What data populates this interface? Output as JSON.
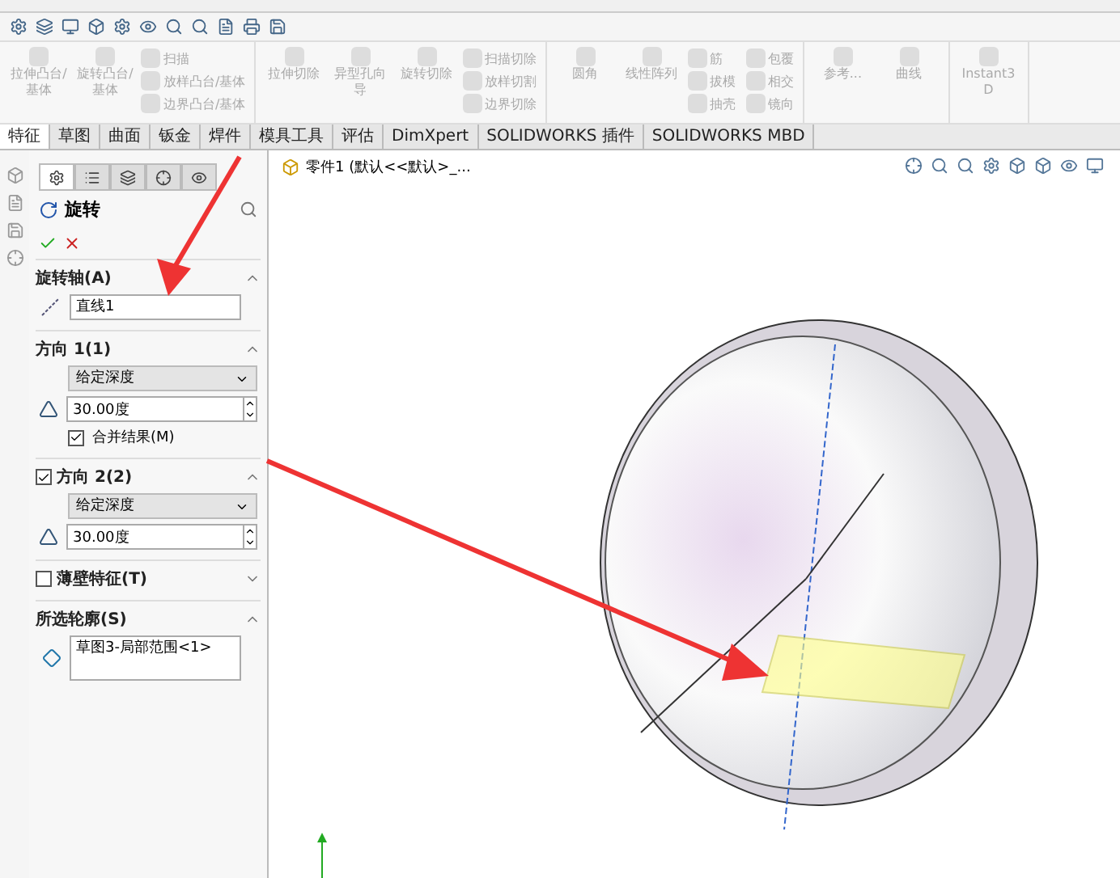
{
  "ribbon": {
    "groups": [
      {
        "large": [
          "拉伸凸台/基体",
          "旋转凸台/基体"
        ],
        "small": [
          "扫描",
          "放样凸台/基体",
          "边界凸台/基体"
        ]
      },
      {
        "large": [
          "拉伸切除",
          "异型孔向导",
          "旋转切除"
        ],
        "small": [
          "扫描切除",
          "放样切割",
          "边界切除"
        ]
      },
      {
        "large": [
          "圆角",
          "线性阵列"
        ],
        "small": [
          "筋",
          "拔模",
          "抽壳",
          "包覆",
          "相交",
          "镜向"
        ]
      },
      {
        "large": [
          "参考...",
          "曲线"
        ]
      },
      {
        "large": [
          "Instant3D"
        ]
      }
    ]
  },
  "tabs": [
    {
      "label": "特征",
      "selected": true
    },
    {
      "label": "草图",
      "selected": false
    },
    {
      "label": "曲面",
      "selected": false
    },
    {
      "label": "钣金",
      "selected": false
    },
    {
      "label": "焊件",
      "selected": false
    },
    {
      "label": "模具工具",
      "selected": false
    },
    {
      "label": "评估",
      "selected": false
    },
    {
      "label": "DimXpert",
      "selected": false
    },
    {
      "label": "SOLIDWORKS 插件",
      "selected": false
    },
    {
      "label": "SOLIDWORKS MBD",
      "selected": false
    }
  ],
  "panel": {
    "title": "旋转",
    "tabs": [
      {
        "selected": true
      },
      {
        "selected": false
      },
      {
        "selected": false
      },
      {
        "selected": false
      },
      {
        "selected": false
      }
    ],
    "sections": [
      {
        "title": "旋转轴(A)",
        "expanded": true,
        "rows": [
          {
            "kind": "field",
            "value": "直线1"
          }
        ]
      },
      {
        "title": "方向 1(1)",
        "expanded": true,
        "rows": [
          {
            "kind": "dropdown",
            "value": "给定深度"
          },
          {
            "kind": "spin",
            "value": "30.00度"
          },
          {
            "kind": "checkbox",
            "label": "合并结果(M)",
            "checked": true
          }
        ]
      },
      {
        "title": "方向 2(2)",
        "checked": true,
        "expanded": true,
        "rows": [
          {
            "kind": "dropdown",
            "value": "给定深度"
          },
          {
            "kind": "spin",
            "value": "30.00度"
          }
        ]
      },
      {
        "title": "薄壁特征(T)",
        "checked": false,
        "expanded": false
      },
      {
        "title": "所选轮廓(S)",
        "expanded": true,
        "rows": [
          {
            "kind": "list",
            "value": "草图3-局部范围<1>"
          }
        ]
      }
    ]
  },
  "viewport": {
    "tree_item": "零件1 (默认<<默认>_..."
  }
}
